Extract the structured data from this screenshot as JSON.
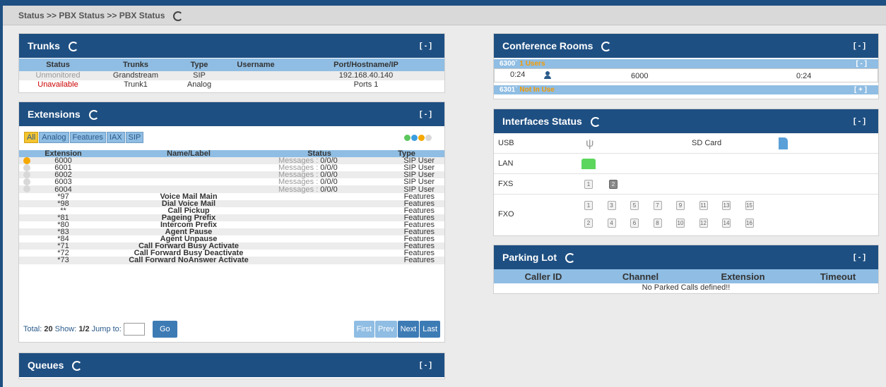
{
  "breadcrumb": "Status >> PBX Status >> PBX Status",
  "collapse_label": "[ - ]",
  "expand_label": "[ + ]",
  "trunks": {
    "title": "Trunks",
    "columns": [
      "Status",
      "Trunks",
      "Type",
      "Username",
      "Port/Hostname/IP"
    ],
    "rows": [
      {
        "status": "Unmonitored",
        "trunk": "Grandstream",
        "type": "SIP",
        "username": "",
        "port": "192.168.40.140"
      },
      {
        "status": "Unavailable",
        "trunk": "Trunk1",
        "type": "Analog",
        "username": "",
        "port": "Ports 1"
      }
    ]
  },
  "extensions": {
    "title": "Extensions",
    "filters": [
      "All",
      "Analog",
      "Features",
      "IAX",
      "SIP"
    ],
    "columns": [
      "Extension",
      "Name/Label",
      "Status",
      "Type"
    ],
    "rows": [
      {
        "ext": "6000",
        "name": "",
        "status": "Messages : 0/0/0",
        "type": "SIP User",
        "dot": "#f5a800"
      },
      {
        "ext": "6001",
        "name": "",
        "status": "Messages : 0/0/0",
        "type": "SIP User",
        "dot": "#d8d8d8"
      },
      {
        "ext": "6002",
        "name": "",
        "status": "Messages : 0/0/0",
        "type": "SIP User",
        "dot": "#d8d8d8"
      },
      {
        "ext": "6003",
        "name": "",
        "status": "Messages : 0/0/0",
        "type": "SIP User",
        "dot": "#d8d8d8"
      },
      {
        "ext": "6004",
        "name": "",
        "status": "Messages : 0/0/0",
        "type": "SIP User",
        "dot": "#d8d8d8"
      },
      {
        "ext": "*97",
        "name": "Voice Mail Main",
        "status": "",
        "type": "Features",
        "dot": ""
      },
      {
        "ext": "*98",
        "name": "Dial Voice Mail",
        "status": "",
        "type": "Features",
        "dot": ""
      },
      {
        "ext": "**",
        "name": "Call Pickup",
        "status": "",
        "type": "Features",
        "dot": ""
      },
      {
        "ext": "*81",
        "name": "Pageing Prefix",
        "status": "",
        "type": "Features",
        "dot": ""
      },
      {
        "ext": "*80",
        "name": "Intercom Prefix",
        "status": "",
        "type": "Features",
        "dot": ""
      },
      {
        "ext": "*83",
        "name": "Agent Pause",
        "status": "",
        "type": "Features",
        "dot": ""
      },
      {
        "ext": "*84",
        "name": "Agent Unpause",
        "status": "",
        "type": "Features",
        "dot": ""
      },
      {
        "ext": "*71",
        "name": "Call Forward Busy Activate",
        "status": "",
        "type": "Features",
        "dot": ""
      },
      {
        "ext": "*72",
        "name": "Call Forward Busy Deactivate",
        "status": "",
        "type": "Features",
        "dot": ""
      },
      {
        "ext": "*73",
        "name": "Call Forward NoAnswer Activate",
        "status": "",
        "type": "Features",
        "dot": ""
      }
    ],
    "footer": {
      "total_label": "Total:",
      "total": "20",
      "show_label": "Show:",
      "show": "1/2",
      "jump_label": "Jump to:",
      "go": "Go",
      "first": "First",
      "prev": "Prev",
      "next": "Next",
      "last": "Last"
    }
  },
  "queues": {
    "title": "Queues"
  },
  "conference": {
    "title": "Conference Rooms",
    "rooms": [
      {
        "number": "6300",
        "sep": "`",
        "state": "1 Users",
        "toggle": "[ - ]"
      },
      {
        "number": "6301",
        "sep": "`",
        "state": "Not In Use",
        "toggle": "[ + ]"
      }
    ],
    "member": {
      "time1": "0:24",
      "ext": "6000",
      "time2": "0:24"
    }
  },
  "interfaces": {
    "title": "Interfaces Status",
    "usb": "USB",
    "sd": "SD Card",
    "lan": "LAN",
    "fxs": "FXS",
    "fxo": "FXO",
    "fxs_ports": [
      "1",
      "2"
    ],
    "fxo_top": [
      "1",
      "3",
      "5",
      "7",
      "9",
      "11",
      "13",
      "15"
    ],
    "fxo_bottom": [
      "2",
      "4",
      "6",
      "8",
      "10",
      "12",
      "14",
      "16"
    ]
  },
  "parking": {
    "title": "Parking Lot",
    "columns": [
      "Caller ID",
      "Channel",
      "Extension",
      "Timeout"
    ],
    "empty": "No Parked Calls defined!!"
  },
  "colors": {
    "header": "#1e4f82",
    "table_head": "#8fbde3",
    "accent": "#f5a800",
    "lan": "#5cd65c"
  }
}
